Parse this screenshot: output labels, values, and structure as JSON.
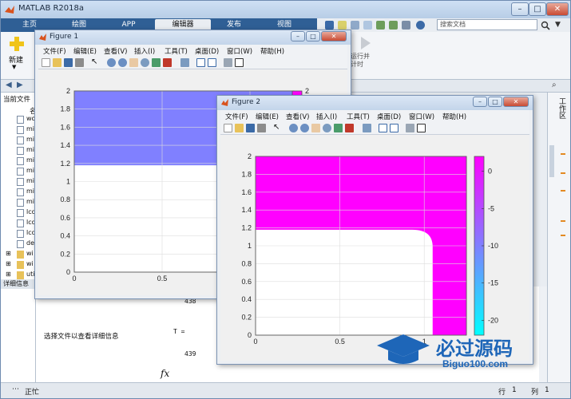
{
  "app": {
    "title": "MATLAB R2018a"
  },
  "tabs": [
    {
      "label": "主页",
      "active": false
    },
    {
      "label": "绘图",
      "active": false
    },
    {
      "label": "APP",
      "active": false
    },
    {
      "label": "编辑器",
      "active": true
    },
    {
      "label": "发布",
      "active": false
    },
    {
      "label": "视图",
      "active": false
    }
  ],
  "search": {
    "placeholder": "搜索文档"
  },
  "ribbon": {
    "new_label": "新建",
    "run_label": "运行并计时"
  },
  "left_panel": {
    "header": "当前文件",
    "col_name": "名",
    "files": [
      "wo",
      "mi",
      "mi",
      "mi",
      "mi",
      "mi",
      "mi",
      "mi",
      "mi",
      "lcd",
      "lcd",
      "lcd",
      "dev",
      "wi",
      "wi",
      "uti"
    ],
    "detail_header": "详细信息",
    "detail_text": "选择文件以查看详细信息"
  },
  "cmd": {
    "line1": "438",
    "line2": "T =",
    "line3": "439",
    "fx": "fx"
  },
  "status": {
    "state": "正忙",
    "row_label": "行",
    "row_value": "1",
    "col_label": "列",
    "col_value": "1"
  },
  "right_strip": {
    "label": "工作区"
  },
  "figure1": {
    "title": "Figure 1",
    "menu": [
      "文件(F)",
      "编辑(E)",
      "查看(V)",
      "插入(I)",
      "工具(T)",
      "桌面(D)",
      "窗口(W)",
      "帮助(H)"
    ],
    "colorbar_top": "2"
  },
  "figure2": {
    "title": "Figure 2",
    "menu": [
      "文件(F)",
      "编辑(E)",
      "查看(V)",
      "插入(I)",
      "工具(T)",
      "桌面(D)",
      "窗口(W)",
      "帮助(H)"
    ]
  },
  "watermark": {
    "brand": "必过源码",
    "url": "Biguo100.com"
  },
  "chart_data": [
    {
      "type": "heatmap",
      "title": "",
      "xlabel": "",
      "ylabel": "",
      "x_ticks": [
        "0",
        "0.5",
        "1"
      ],
      "y_ticks": [
        "0",
        "0.2",
        "0.4",
        "0.6",
        "0.8",
        "1",
        "1.2",
        "1.4",
        "1.6",
        "1.8",
        "2"
      ],
      "xlim": [
        0,
        1.25
      ],
      "ylim": [
        0,
        2
      ],
      "fill_color": "#8080ff",
      "colorbar_ticks": [
        "2"
      ],
      "grid": true
    },
    {
      "type": "heatmap",
      "title": "",
      "xlabel": "",
      "ylabel": "",
      "x_ticks": [
        "0",
        "0.5",
        "1"
      ],
      "y_ticks": [
        "0",
        "0.2",
        "0.4",
        "0.6",
        "0.8",
        "1",
        "1.2",
        "1.4",
        "1.6",
        "1.8",
        "2"
      ],
      "xlim": [
        0,
        1.25
      ],
      "ylim": [
        0,
        2
      ],
      "fill_color": "#ff00ff",
      "colorbar_ticks": [
        "0",
        "-5",
        "-10",
        "-15",
        "-20"
      ],
      "colorbar_range": [
        -22,
        2
      ],
      "colormap": [
        "#00ffff",
        "#ff00ff"
      ],
      "grid": true
    }
  ]
}
